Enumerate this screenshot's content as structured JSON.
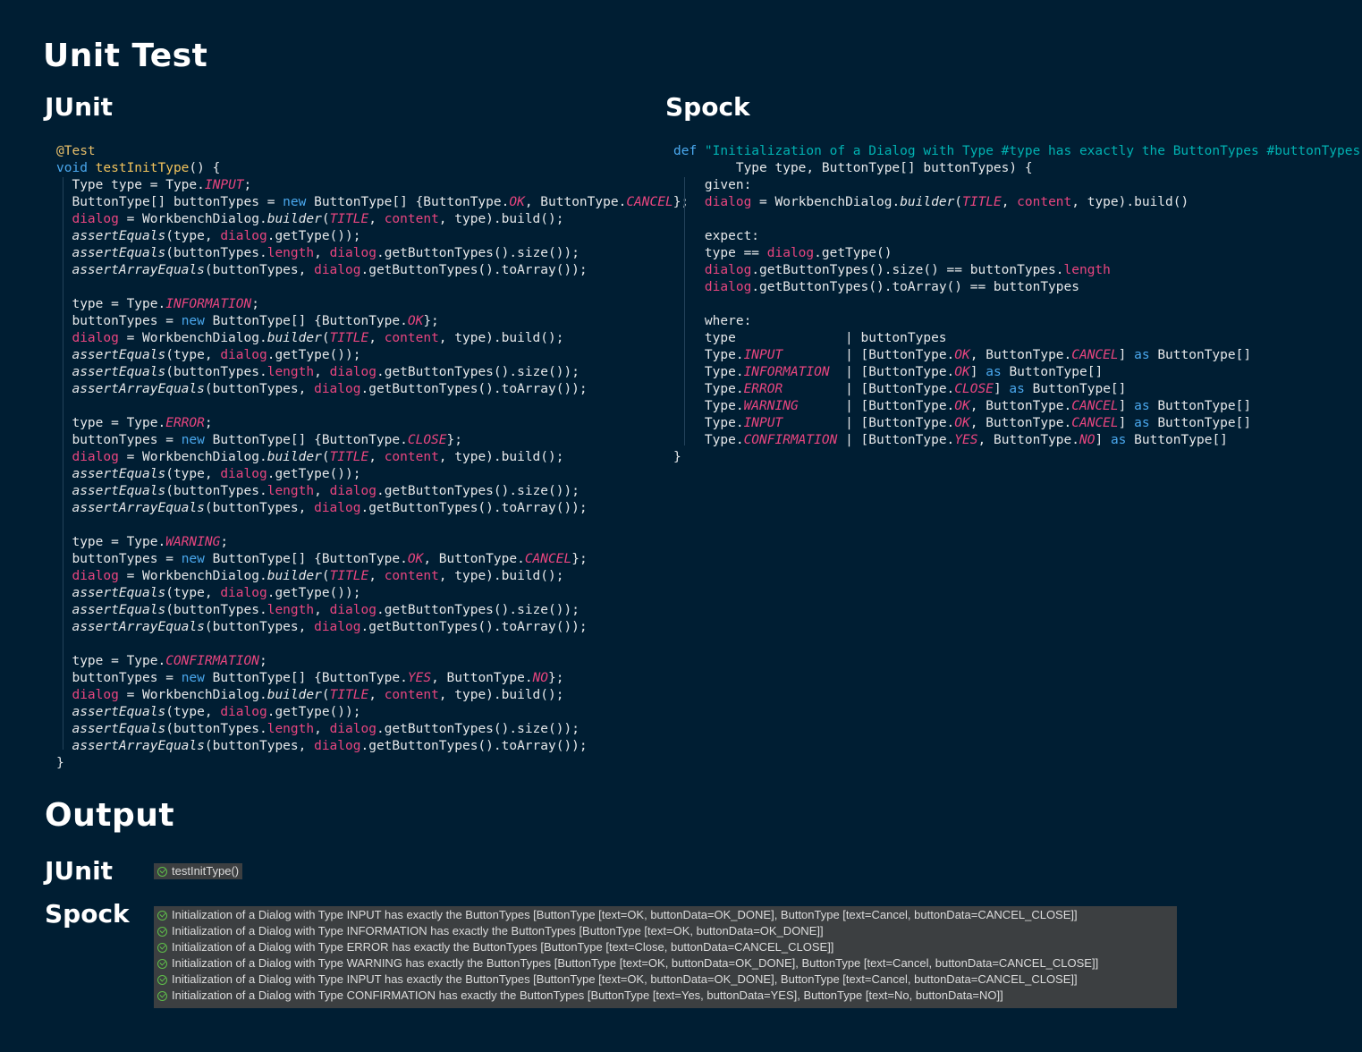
{
  "titles": {
    "unit_test": "Unit Test",
    "junit": "JUnit",
    "spock": "Spock",
    "output": "Output",
    "output_junit": "JUnit",
    "output_spock": "Spock"
  },
  "output": {
    "junit_results": [
      "testInitType()"
    ],
    "spock_results": [
      "Initialization of a Dialog with Type INPUT has exactly the ButtonTypes [ButtonType [text=OK, buttonData=OK_DONE], ButtonType [text=Cancel, buttonData=CANCEL_CLOSE]]",
      "Initialization of a Dialog with Type INFORMATION has exactly the ButtonTypes [ButtonType [text=OK, buttonData=OK_DONE]]",
      "Initialization of a Dialog with Type ERROR has exactly the ButtonTypes [ButtonType [text=Close, buttonData=CANCEL_CLOSE]]",
      "Initialization of a Dialog with Type WARNING has exactly the ButtonTypes [ButtonType [text=OK, buttonData=OK_DONE], ButtonType [text=Cancel, buttonData=CANCEL_CLOSE]]",
      "Initialization of a Dialog with Type INPUT has exactly the ButtonTypes [ButtonType [text=OK, buttonData=OK_DONE], ButtonType [text=Cancel, buttonData=CANCEL_CLOSE]]",
      "Initialization of a Dialog with Type CONFIRMATION has exactly the ButtonTypes [ButtonType [text=Yes, buttonData=YES], ButtonType [text=No, buttonData=NO]]"
    ]
  },
  "icons": {
    "result_status": "check-circle-icon",
    "pass_color": "#5fbf4a"
  },
  "junit_code": [
    [
      [
        "ann",
        "@Test"
      ]
    ],
    [
      [
        "k",
        "void "
      ],
      [
        "fn",
        "testInitType"
      ],
      [
        "",
        "() {"
      ]
    ],
    [
      [
        "",
        "  Type type = Type."
      ],
      [
        "c",
        "INPUT"
      ],
      [
        "",
        ";"
      ]
    ],
    [
      [
        "",
        "  ButtonType[] buttonTypes = "
      ],
      [
        "k",
        "new "
      ],
      [
        "",
        "ButtonType[] {ButtonType."
      ],
      [
        "c",
        "OK"
      ],
      [
        "",
        ", ButtonType."
      ],
      [
        "c",
        "CANCEL"
      ],
      [
        "",
        "};"
      ]
    ],
    [
      [
        "f",
        "  dialog"
      ],
      [
        "",
        " = WorkbenchDialog."
      ],
      [
        "m",
        "builder"
      ],
      [
        "",
        "("
      ],
      [
        "c",
        "TITLE"
      ],
      [
        "",
        ", "
      ],
      [
        "f",
        "content"
      ],
      [
        "",
        ", type).build();"
      ]
    ],
    [
      [
        "m",
        "  assertEquals"
      ],
      [
        "",
        "(type, "
      ],
      [
        "f",
        "dialog"
      ],
      [
        "",
        ".getType());"
      ]
    ],
    [
      [
        "m",
        "  assertEquals"
      ],
      [
        "",
        "(buttonTypes."
      ],
      [
        "f",
        "length"
      ],
      [
        "",
        ", "
      ],
      [
        "f",
        "dialog"
      ],
      [
        "",
        ".getButtonTypes().size());"
      ]
    ],
    [
      [
        "m",
        "  assertArrayEquals"
      ],
      [
        "",
        "(buttonTypes, "
      ],
      [
        "f",
        "dialog"
      ],
      [
        "",
        ".getButtonTypes().toArray());"
      ]
    ],
    [],
    [
      [
        "",
        "  type = Type."
      ],
      [
        "c",
        "INFORMATION"
      ],
      [
        "",
        ";"
      ]
    ],
    [
      [
        "",
        "  buttonTypes = "
      ],
      [
        "k",
        "new "
      ],
      [
        "",
        "ButtonType[] {ButtonType."
      ],
      [
        "c",
        "OK"
      ],
      [
        "",
        "};"
      ]
    ],
    [
      [
        "f",
        "  dialog"
      ],
      [
        "",
        " = WorkbenchDialog."
      ],
      [
        "m",
        "builder"
      ],
      [
        "",
        "("
      ],
      [
        "c",
        "TITLE"
      ],
      [
        "",
        ", "
      ],
      [
        "f",
        "content"
      ],
      [
        "",
        ", type).build();"
      ]
    ],
    [
      [
        "m",
        "  assertEquals"
      ],
      [
        "",
        "(type, "
      ],
      [
        "f",
        "dialog"
      ],
      [
        "",
        ".getType());"
      ]
    ],
    [
      [
        "m",
        "  assertEquals"
      ],
      [
        "",
        "(buttonTypes."
      ],
      [
        "f",
        "length"
      ],
      [
        "",
        ", "
      ],
      [
        "f",
        "dialog"
      ],
      [
        "",
        ".getButtonTypes().size());"
      ]
    ],
    [
      [
        "m",
        "  assertArrayEquals"
      ],
      [
        "",
        "(buttonTypes, "
      ],
      [
        "f",
        "dialog"
      ],
      [
        "",
        ".getButtonTypes().toArray());"
      ]
    ],
    [],
    [
      [
        "",
        "  type = Type."
      ],
      [
        "c",
        "ERROR"
      ],
      [
        "",
        ";"
      ]
    ],
    [
      [
        "",
        "  buttonTypes = "
      ],
      [
        "k",
        "new "
      ],
      [
        "",
        "ButtonType[] {ButtonType."
      ],
      [
        "c",
        "CLOSE"
      ],
      [
        "",
        "};"
      ]
    ],
    [
      [
        "f",
        "  dialog"
      ],
      [
        "",
        " = WorkbenchDialog."
      ],
      [
        "m",
        "builder"
      ],
      [
        "",
        "("
      ],
      [
        "c",
        "TITLE"
      ],
      [
        "",
        ", "
      ],
      [
        "f",
        "content"
      ],
      [
        "",
        ", type).build();"
      ]
    ],
    [
      [
        "m",
        "  assertEquals"
      ],
      [
        "",
        "(type, "
      ],
      [
        "f",
        "dialog"
      ],
      [
        "",
        ".getType());"
      ]
    ],
    [
      [
        "m",
        "  assertEquals"
      ],
      [
        "",
        "(buttonTypes."
      ],
      [
        "f",
        "length"
      ],
      [
        "",
        ", "
      ],
      [
        "f",
        "dialog"
      ],
      [
        "",
        ".getButtonTypes().size());"
      ]
    ],
    [
      [
        "m",
        "  assertArrayEquals"
      ],
      [
        "",
        "(buttonTypes, "
      ],
      [
        "f",
        "dialog"
      ],
      [
        "",
        ".getButtonTypes().toArray());"
      ]
    ],
    [],
    [
      [
        "",
        "  type = Type."
      ],
      [
        "c",
        "WARNING"
      ],
      [
        "",
        ";"
      ]
    ],
    [
      [
        "",
        "  buttonTypes = "
      ],
      [
        "k",
        "new "
      ],
      [
        "",
        "ButtonType[] {ButtonType."
      ],
      [
        "c",
        "OK"
      ],
      [
        "",
        ", ButtonType."
      ],
      [
        "c",
        "CANCEL"
      ],
      [
        "",
        "};"
      ]
    ],
    [
      [
        "f",
        "  dialog"
      ],
      [
        "",
        " = WorkbenchDialog."
      ],
      [
        "m",
        "builder"
      ],
      [
        "",
        "("
      ],
      [
        "c",
        "TITLE"
      ],
      [
        "",
        ", "
      ],
      [
        "f",
        "content"
      ],
      [
        "",
        ", type).build();"
      ]
    ],
    [
      [
        "m",
        "  assertEquals"
      ],
      [
        "",
        "(type, "
      ],
      [
        "f",
        "dialog"
      ],
      [
        "",
        ".getType());"
      ]
    ],
    [
      [
        "m",
        "  assertEquals"
      ],
      [
        "",
        "(buttonTypes."
      ],
      [
        "f",
        "length"
      ],
      [
        "",
        ", "
      ],
      [
        "f",
        "dialog"
      ],
      [
        "",
        ".getButtonTypes().size());"
      ]
    ],
    [
      [
        "m",
        "  assertArrayEquals"
      ],
      [
        "",
        "(buttonTypes, "
      ],
      [
        "f",
        "dialog"
      ],
      [
        "",
        ".getButtonTypes().toArray());"
      ]
    ],
    [],
    [
      [
        "",
        "  type = Type."
      ],
      [
        "c",
        "CONFIRMATION"
      ],
      [
        "",
        ";"
      ]
    ],
    [
      [
        "",
        "  buttonTypes = "
      ],
      [
        "k",
        "new "
      ],
      [
        "",
        "ButtonType[] {ButtonType."
      ],
      [
        "c",
        "YES"
      ],
      [
        "",
        ", ButtonType."
      ],
      [
        "c",
        "NO"
      ],
      [
        "",
        "};"
      ]
    ],
    [
      [
        "f",
        "  dialog"
      ],
      [
        "",
        " = WorkbenchDialog."
      ],
      [
        "m",
        "builder"
      ],
      [
        "",
        "("
      ],
      [
        "c",
        "TITLE"
      ],
      [
        "",
        ", "
      ],
      [
        "f",
        "content"
      ],
      [
        "",
        ", type).build();"
      ]
    ],
    [
      [
        "m",
        "  assertEquals"
      ],
      [
        "",
        "(type, "
      ],
      [
        "f",
        "dialog"
      ],
      [
        "",
        ".getType());"
      ]
    ],
    [
      [
        "m",
        "  assertEquals"
      ],
      [
        "",
        "(buttonTypes."
      ],
      [
        "f",
        "length"
      ],
      [
        "",
        ", "
      ],
      [
        "f",
        "dialog"
      ],
      [
        "",
        ".getButtonTypes().size());"
      ]
    ],
    [
      [
        "m",
        "  assertArrayEquals"
      ],
      [
        "",
        "(buttonTypes, "
      ],
      [
        "f",
        "dialog"
      ],
      [
        "",
        ".getButtonTypes().toArray());"
      ]
    ],
    [
      [
        "",
        "}"
      ]
    ]
  ],
  "spock_code": [
    [
      [
        "k",
        "def "
      ],
      [
        "s",
        "\"Initialization of a Dialog with Type #type has exactly the ButtonTypes #buttonTypes\""
      ],
      [
        "",
        "("
      ]
    ],
    [
      [
        "",
        "        Type type, ButtonType[] buttonTypes) {"
      ]
    ],
    [
      [
        "",
        "    given:"
      ]
    ],
    [
      [
        "f",
        "    dialog"
      ],
      [
        "",
        " = WorkbenchDialog."
      ],
      [
        "m",
        "builder"
      ],
      [
        "",
        "("
      ],
      [
        "c",
        "TITLE"
      ],
      [
        "",
        ", "
      ],
      [
        "f",
        "content"
      ],
      [
        "",
        ", type).build()"
      ]
    ],
    [],
    [
      [
        "",
        "    expect:"
      ]
    ],
    [
      [
        "",
        "    type == "
      ],
      [
        "f",
        "dialog"
      ],
      [
        "",
        ".getType()"
      ]
    ],
    [
      [
        "f",
        "    dialog"
      ],
      [
        "",
        ".getButtonTypes().size() == buttonTypes."
      ],
      [
        "f",
        "length"
      ]
    ],
    [
      [
        "f",
        "    dialog"
      ],
      [
        "",
        ".getButtonTypes().toArray() == buttonTypes"
      ]
    ],
    [],
    [
      [
        "",
        "    where:"
      ]
    ],
    [
      [
        "",
        "    type              | buttonTypes"
      ]
    ],
    [
      [
        "",
        "    Type."
      ],
      [
        "c",
        "INPUT"
      ],
      [
        "",
        "        | [ButtonType."
      ],
      [
        "c",
        "OK"
      ],
      [
        "",
        ", ButtonType."
      ],
      [
        "c",
        "CANCEL"
      ],
      [
        "",
        "] "
      ],
      [
        "k",
        "as "
      ],
      [
        "",
        "ButtonType[]"
      ]
    ],
    [
      [
        "",
        "    Type."
      ],
      [
        "c",
        "INFORMATION"
      ],
      [
        "",
        "  | [ButtonType."
      ],
      [
        "c",
        "OK"
      ],
      [
        "",
        "] "
      ],
      [
        "k",
        "as "
      ],
      [
        "",
        "ButtonType[]"
      ]
    ],
    [
      [
        "",
        "    Type."
      ],
      [
        "c",
        "ERROR"
      ],
      [
        "",
        "        | [ButtonType."
      ],
      [
        "c",
        "CLOSE"
      ],
      [
        "",
        "] "
      ],
      [
        "k",
        "as "
      ],
      [
        "",
        "ButtonType[]"
      ]
    ],
    [
      [
        "",
        "    Type."
      ],
      [
        "c",
        "WARNING"
      ],
      [
        "",
        "      | [ButtonType."
      ],
      [
        "c",
        "OK"
      ],
      [
        "",
        ", ButtonType."
      ],
      [
        "c",
        "CANCEL"
      ],
      [
        "",
        "] "
      ],
      [
        "k",
        "as "
      ],
      [
        "",
        "ButtonType[]"
      ]
    ],
    [
      [
        "",
        "    Type."
      ],
      [
        "c",
        "INPUT"
      ],
      [
        "",
        "        | [ButtonType."
      ],
      [
        "c",
        "OK"
      ],
      [
        "",
        ", ButtonType."
      ],
      [
        "c",
        "CANCEL"
      ],
      [
        "",
        "] "
      ],
      [
        "k",
        "as "
      ],
      [
        "",
        "ButtonType[]"
      ]
    ],
    [
      [
        "",
        "    Type."
      ],
      [
        "c",
        "CONFIRMATION"
      ],
      [
        "",
        " | [ButtonType."
      ],
      [
        "c",
        "YES"
      ],
      [
        "",
        ", ButtonType."
      ],
      [
        "c",
        "NO"
      ],
      [
        "",
        "] "
      ],
      [
        "k",
        "as "
      ],
      [
        "",
        "ButtonType[]"
      ]
    ],
    [
      [
        "",
        "}"
      ]
    ]
  ]
}
